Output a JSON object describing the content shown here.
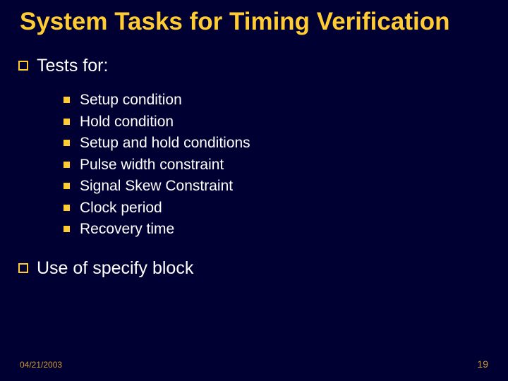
{
  "title": "System Tasks for Timing Verification",
  "bullets": {
    "first": "Tests for:",
    "sub": {
      "i0": "Setup condition",
      "i1": "Hold condition",
      "i2": "Setup and hold conditions",
      "i3": "Pulse width constraint",
      "i4": "Signal Skew Constraint",
      "i5": "Clock period",
      "i6": "Recovery time"
    },
    "second": "Use of specify block"
  },
  "footer": {
    "date": "04/21/2003",
    "page": "19"
  }
}
